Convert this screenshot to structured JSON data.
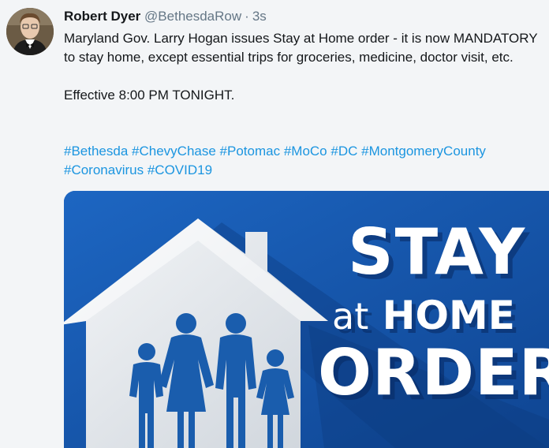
{
  "author": {
    "name": "Robert Dyer",
    "handle": "@BethesdaRow",
    "separator": "·",
    "time": "3s"
  },
  "tweet": {
    "line1": "Maryland Gov. Larry Hogan issues Stay at Home order - it is now MANDATORY to stay home, except essential trips for groceries, medicine, doctor visit, etc.",
    "line2": "Effective 8:00 PM TONIGHT.",
    "hashtags": [
      "#Bethesda",
      "#ChevyChase",
      "#Potomac",
      "#MoCo",
      "#DC",
      "#MontgomeryCounty",
      "#Coronavirus",
      "#COVID19"
    ]
  },
  "media": {
    "line1": "STAY",
    "line2_small": "at",
    "line2_big": "HOME",
    "line3": "ORDER"
  },
  "colors": {
    "hashtag": "#1b95e0",
    "media_bg": "#1553a8",
    "icon_blue": "#1a5dad"
  }
}
